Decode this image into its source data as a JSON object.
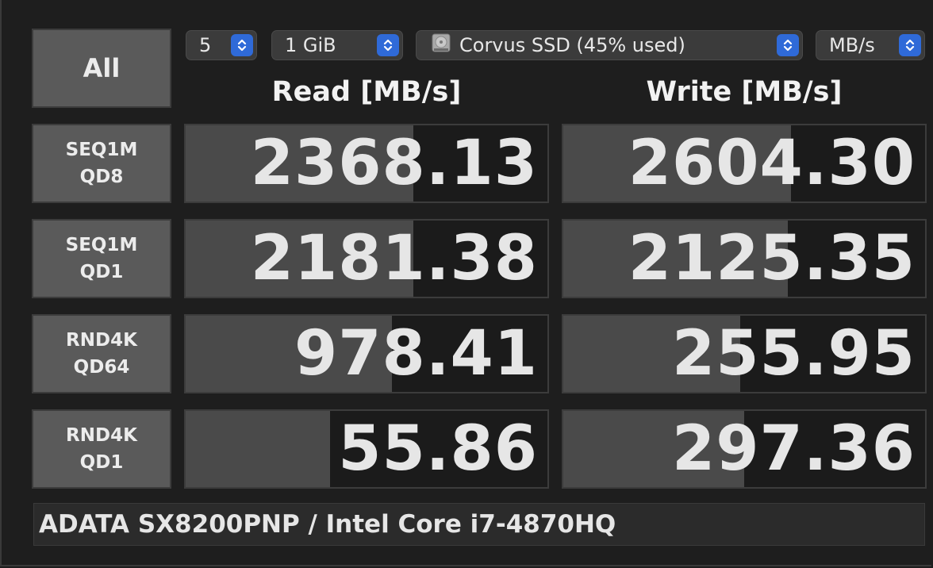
{
  "all_button": "All",
  "controls": {
    "count": "5",
    "size": "1 GiB",
    "drive": "Corvus SSD (45% used)",
    "unit": "MB/s"
  },
  "headers": {
    "read": "Read [MB/s]",
    "write": "Write [MB/s]"
  },
  "tests": [
    {
      "line1": "SEQ1M",
      "line2": "QD8",
      "read": "2368.13",
      "write": "2604.30",
      "read_fill": 0.63,
      "write_fill": 0.63
    },
    {
      "line1": "SEQ1M",
      "line2": "QD1",
      "read": "2181.38",
      "write": "2125.35",
      "read_fill": 0.63,
      "write_fill": 0.62
    },
    {
      "line1": "RND4K",
      "line2": "QD64",
      "read": "978.41",
      "write": "255.95",
      "read_fill": 0.57,
      "write_fill": 0.49
    },
    {
      "line1": "RND4K",
      "line2": "QD1",
      "read": "55.86",
      "write": "297.36",
      "read_fill": 0.4,
      "write_fill": 0.5
    }
  ],
  "comment": "ADATA SX8200PNP / Intel Core i7-4870HQ",
  "colors": {
    "accent": "#2f6ad8",
    "bar": "#4a4a4a",
    "button": "#5a5a5a"
  },
  "icons": {
    "select_arrows": "updown-chevron-icon",
    "drive": "hard-disk-icon"
  }
}
